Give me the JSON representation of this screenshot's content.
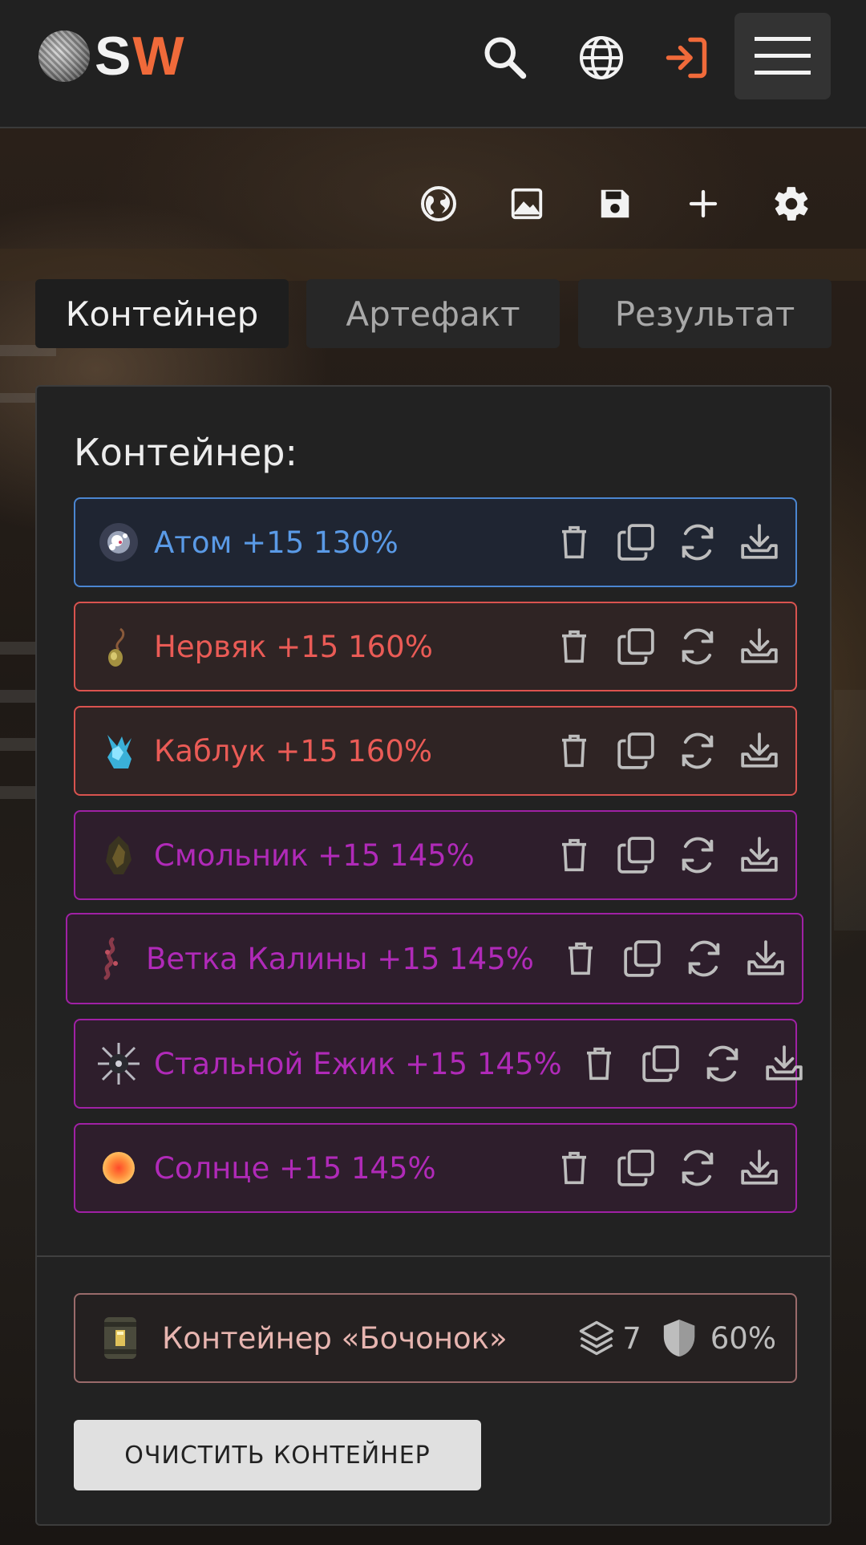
{
  "header": {
    "logo_letters": [
      "S",
      "W"
    ],
    "icons": [
      "search-icon",
      "globe-icon",
      "login-icon",
      "menu-icon"
    ],
    "accent": "#f06a3a"
  },
  "toolbar": {
    "icons": [
      "map-icon",
      "image-icon",
      "save-icon",
      "plus-icon",
      "gear-icon"
    ]
  },
  "tabs": [
    {
      "label": "Контейнер",
      "active": true
    },
    {
      "label": "Артефакт",
      "active": false
    },
    {
      "label": "Результат",
      "active": false
    }
  ],
  "panel": {
    "title": "Контейнер:",
    "items": [
      {
        "label": "Атом +15 130%",
        "color": "blue",
        "icon": "atom-artifact-icon"
      },
      {
        "label": "Нервяк +15 160%",
        "color": "red",
        "icon": "nervyak-artifact-icon"
      },
      {
        "label": "Каблук +15 160%",
        "color": "red",
        "icon": "crystal-artifact-icon"
      },
      {
        "label": "Смольник +15 145%",
        "color": "purple",
        "icon": "resin-artifact-icon"
      },
      {
        "label": "Ветка Калины +15 145%",
        "color": "purple",
        "icon": "branch-artifact-icon"
      },
      {
        "label": "Стальной Ежик +15 145%",
        "color": "purple",
        "icon": "spiky-artifact-icon"
      },
      {
        "label": "Солнце +15 145%",
        "color": "purple",
        "icon": "sun-artifact-icon"
      }
    ],
    "item_actions": [
      "trash-icon",
      "copy-icon",
      "swap-icon",
      "download-icon"
    ],
    "container": {
      "name": "Контейнер «Бочонок»",
      "slots": "7",
      "protection": "60%"
    },
    "clear_button": "ОЧИСТИТЬ КОНТЕЙНЕР"
  },
  "colors": {
    "blue": "#5a9ae6",
    "red": "#ea5b56",
    "purple": "#b02ab8"
  }
}
